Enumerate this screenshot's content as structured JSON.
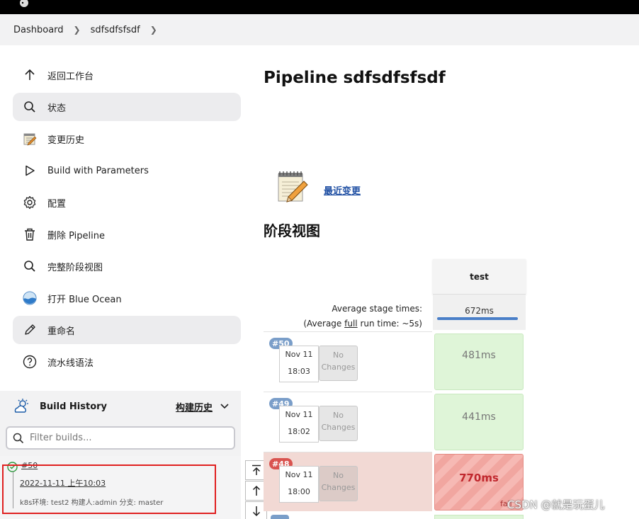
{
  "breadcrumb": {
    "items": [
      "Dashboard",
      "sdfsdfsfsdf"
    ]
  },
  "sidebar": {
    "items": [
      {
        "label": "返回工作台",
        "icon": "arrow-up-icon"
      },
      {
        "label": "状态",
        "icon": "search-icon"
      },
      {
        "label": "变更历史",
        "icon": "notepad-icon"
      },
      {
        "label": "Build with Parameters",
        "icon": "play-icon"
      },
      {
        "label": "配置",
        "icon": "gear-icon"
      },
      {
        "label": "删除 Pipeline",
        "icon": "trash-icon"
      },
      {
        "label": "完整阶段视图",
        "icon": "search-icon"
      },
      {
        "label": "打开 Blue Ocean",
        "icon": "blue-ocean-icon"
      },
      {
        "label": "重命名",
        "icon": "pencil-icon"
      },
      {
        "label": "流水线语法",
        "icon": "help-icon"
      }
    ]
  },
  "build_history": {
    "title": "Build History",
    "toggle_label": "构建历史",
    "filter_placeholder": "Filter builds...",
    "entry": {
      "number": "#50",
      "date": "2022-11-11 上午10:03",
      "description": "k8s环境: test2 构建人:admin 分支: master"
    }
  },
  "main": {
    "title": "Pipeline sdfsdfsfsdf",
    "recent_changes": "最近变更",
    "stage_view_title": "阶段视图"
  },
  "stage_view": {
    "stage_name": "test",
    "avg_stage_label": "Average stage times:",
    "avg_full_prefix": "(Average ",
    "avg_full_word": "full",
    "avg_full_suffix": " run time: ~5s)",
    "avg_stage_time": "672ms",
    "runs": [
      {
        "number": "#50",
        "month_day": "Nov 11",
        "time": "18:03",
        "changes_line1": "No",
        "changes_line2": "Changes",
        "stage_time": "481ms",
        "status": "success"
      },
      {
        "number": "#49",
        "month_day": "Nov 11",
        "time": "18:02",
        "changes_line1": "No",
        "changes_line2": "Changes",
        "stage_time": "441ms",
        "status": "success"
      },
      {
        "number": "#48",
        "month_day": "Nov 11",
        "time": "18:00",
        "changes_line1": "No",
        "changes_line2": "Changes",
        "stage_time": "770ms",
        "status": "failed"
      }
    ],
    "failed_label": "fail"
  },
  "watermark": "CSDN @就是玩蛋儿",
  "colors": {
    "success": "#dff5d8",
    "failed": "#f1a6a0",
    "link": "#1f4fa3",
    "highlight": "#e02020"
  }
}
